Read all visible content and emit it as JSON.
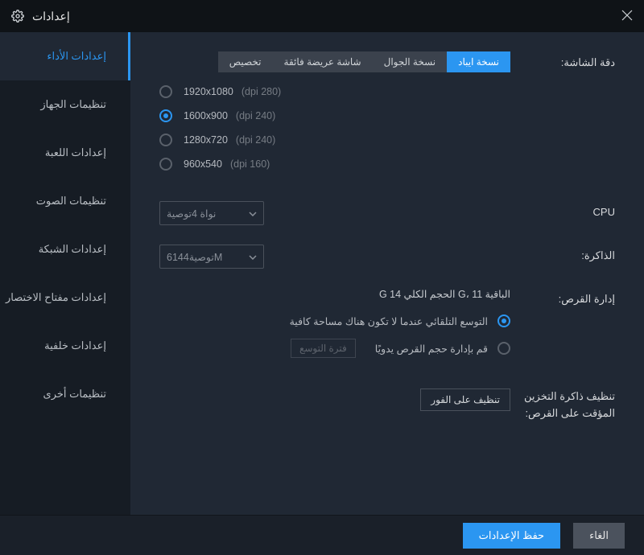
{
  "title": "إعدادات",
  "sidebar": {
    "items": [
      {
        "label": "إعدادات الأداء"
      },
      {
        "label": "تنظيمات الجهاز"
      },
      {
        "label": "إعدادات اللعبة"
      },
      {
        "label": "تنظيمات الصوت"
      },
      {
        "label": "إعدادات الشبكة"
      },
      {
        "label": "إعدادات مفتاح الاختصار"
      },
      {
        "label": "إعدادات خلفية"
      },
      {
        "label": "تنظيمات أخرى"
      }
    ]
  },
  "resolution": {
    "label": "دقة الشاشة:",
    "tabs": [
      {
        "label": "نسخة ايباد"
      },
      {
        "label": "نسخة الجوال"
      },
      {
        "label": "شاشة عريضة فائقة"
      },
      {
        "label": "تخصيص"
      }
    ],
    "options": [
      {
        "res": "1920x1080",
        "dpi": "(dpi 280)"
      },
      {
        "res": "1600x900",
        "dpi": "(dpi 240)"
      },
      {
        "res": "1280x720",
        "dpi": "(dpi 240)"
      },
      {
        "res": "960x540",
        "dpi": "(dpi 160)"
      }
    ]
  },
  "cpu": {
    "label": "CPU",
    "value": "نواة 4توصية"
  },
  "memory": {
    "label": "الذاكرة:",
    "value": "توصية6144M"
  },
  "disk": {
    "label": "إدارة القرص:",
    "info": "الباقية G،  11  الحجم الكلي 14  G",
    "opt_auto": "التوسع التلقائي عندما لا تكون هناك مساحة كافية",
    "opt_manual": "قم بإدارة حجم القرص يدويًا",
    "expand_btn": "فترة التوسع"
  },
  "cache": {
    "label": "تنظيف ذاكرة التخزين المؤقت على القرص:",
    "btn": "تنظيف على الفور"
  },
  "footer": {
    "save": "حفظ الإعدادات",
    "cancel": "الغاء"
  }
}
